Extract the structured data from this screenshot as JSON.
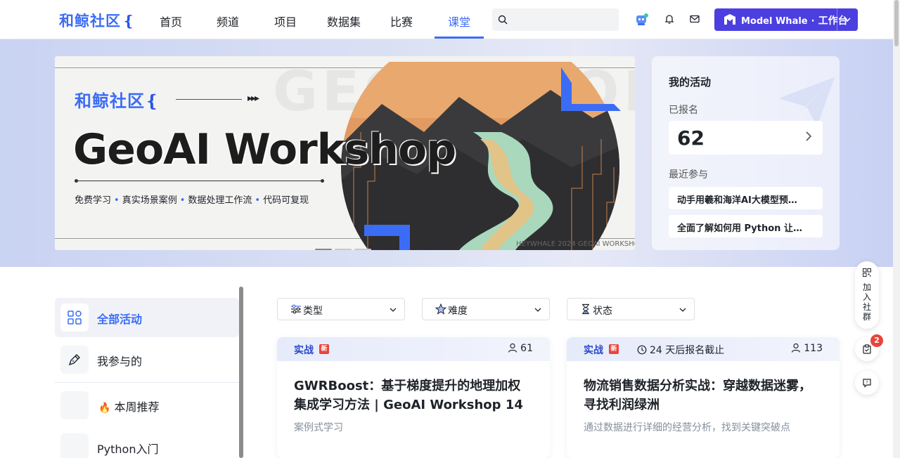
{
  "brand": {
    "logo": "和鲸社区",
    "logo_mark": "❴"
  },
  "nav": {
    "items": [
      {
        "label": "首页"
      },
      {
        "label": "频道"
      },
      {
        "label": "项目"
      },
      {
        "label": "数据集"
      },
      {
        "label": "比赛"
      },
      {
        "label": "课堂"
      }
    ],
    "active": "课堂",
    "search_placeholder": "",
    "workbench": {
      "brand": "Model Whale",
      "separator": "·",
      "label": "工作台"
    }
  },
  "banner": {
    "logo": "和鲸社区",
    "title": "GeoAI Workshop",
    "ghost_text": "GEOAI WORKSHOP",
    "tags": [
      "免费学习",
      "真实场景案例",
      "数据处理工作流",
      "代码可复现"
    ],
    "footer": "HEYWHALE 2024 GEOAI WORKSHOP",
    "slides": 3,
    "active_slide": 1
  },
  "activity": {
    "heading": "我的活动",
    "registered_label": "已报名",
    "registered_count": "62",
    "recent_label": "最近参与",
    "recent": [
      "动手用羲和海洋AI大模型预…",
      "全面了解如何用 Python 让…"
    ]
  },
  "sidebar": {
    "items": [
      {
        "label": "全部活动",
        "icon": "grid-icon",
        "active": true
      },
      {
        "label": "我参与的",
        "icon": "pen-icon",
        "active": false
      },
      {
        "label": "本周推荐",
        "icon": "fire-icon",
        "emoji": "🔥",
        "active": false
      },
      {
        "label": "Python入门",
        "icon": "python-icon",
        "active": false
      }
    ]
  },
  "filters": [
    {
      "label": "类型",
      "icon": "sliders-icon"
    },
    {
      "label": "难度",
      "icon": "star-icon"
    },
    {
      "label": "状态",
      "icon": "hourglass-icon"
    }
  ],
  "cards": [
    {
      "type": "实战",
      "new_badge": "新",
      "deadline": "",
      "participants": "61",
      "title": "GWRBoost：基于梯度提升的地理加权集成学习方法 | GeoAI Workshop 14",
      "desc": "案例式学习"
    },
    {
      "type": "实战",
      "new_badge": "新",
      "deadline": "24 天后报名截止",
      "participants": "113",
      "title": "物流销售数据分析实战：穿越数据迷雾，寻找利润绿洲",
      "desc": "通过数据进行详细的经营分析，找到关键突破点"
    }
  ],
  "floating": {
    "join_label": "加入社群",
    "badge_count": "2"
  },
  "colors": {
    "accent": "#3b6cf6",
    "workbench": "#4c3fe0",
    "badge": "#e8443a"
  }
}
